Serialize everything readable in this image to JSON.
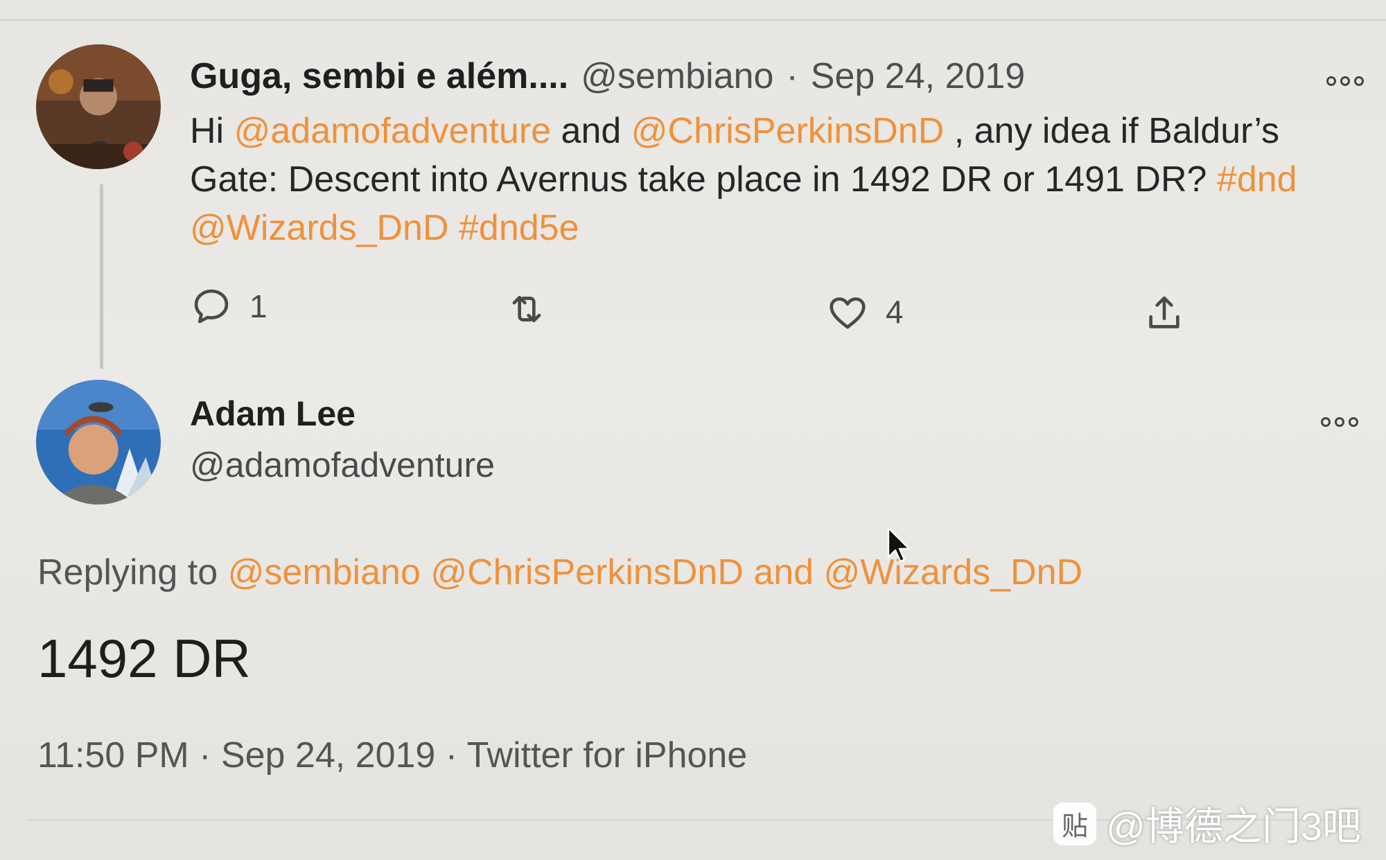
{
  "tweet": {
    "display_name": "Guga, sembi e além....",
    "handle": "@sembiano",
    "separator": "·",
    "date": "Sep 24, 2019",
    "text_parts": {
      "p1": "Hi ",
      "m1": "@adamofadventure",
      "p2": " and ",
      "m2": "@ChrisPerkinsDnD",
      "p3": " , any idea if Baldur’s Gate: Descent into Avernus take place in 1492 DR or 1491 DR? ",
      "h1": "#dnd",
      "p4": " ",
      "m3": "@Wizards_DnD",
      "p5": " ",
      "h2": "#dnd5e"
    },
    "actions": {
      "reply_count": "1",
      "retweet_count": "",
      "like_count": "4"
    }
  },
  "reply": {
    "display_name": "Adam Lee",
    "handle": "@adamofadventure",
    "replying_label": "Replying to",
    "replying_to": {
      "u1": "@sembiano",
      "u2": "@ChrisPerkinsDnD",
      "and_word": "and",
      "u3": "@Wizards_DnD"
    },
    "text": "1492 DR",
    "time": "11:50 PM",
    "separator": "·",
    "date": "Sep 24, 2019",
    "source": "Twitter for iPhone"
  },
  "watermark": {
    "badge": "贴",
    "text": "@博德之门3吧"
  },
  "colors": {
    "link": "#f0913a",
    "text": "#262626",
    "muted": "#4e4e4e",
    "background": "#e9e8e5"
  },
  "icons": [
    "reply-icon",
    "retweet-icon",
    "like-icon",
    "share-icon",
    "more-icon",
    "cursor-icon"
  ]
}
